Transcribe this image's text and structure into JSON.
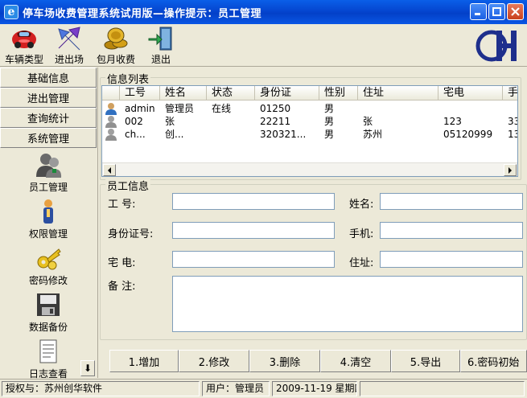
{
  "window": {
    "title": "停车场收费管理系统试用版—操作提示：员工管理",
    "app_icon_glyph": "e"
  },
  "toolbar": {
    "items": [
      {
        "label": "车辆类型",
        "icon": "red-car-icon"
      },
      {
        "label": "进出场",
        "icon": "in-out-arrows-icon"
      },
      {
        "label": "包月收费",
        "icon": "coins-icon"
      },
      {
        "label": "退出",
        "icon": "exit-door-icon"
      }
    ],
    "logo_text": "H"
  },
  "sidebar": {
    "sections": [
      "基础信息",
      "进出管理",
      "查询统计",
      "系统管理"
    ],
    "items": [
      {
        "label": "员工管理",
        "icon": "users-icon"
      },
      {
        "label": "权限管理",
        "icon": "permission-icon"
      },
      {
        "label": "密码修改",
        "icon": "keys-icon"
      },
      {
        "label": "数据备份",
        "icon": "backup-icon"
      },
      {
        "label": "日志查看",
        "icon": "log-icon"
      }
    ],
    "scroll_glyph": "⬇"
  },
  "list": {
    "group_title": "信息列表",
    "columns": [
      "",
      "工号",
      "姓名",
      "状态",
      "身份证",
      "性别",
      "住址",
      "宅电",
      "手"
    ],
    "rows": [
      [
        "",
        "admin",
        "管理员",
        "在线",
        "01250",
        "男",
        "",
        "",
        ""
      ],
      [
        "",
        "002",
        "张",
        "",
        "22211",
        "男",
        "张",
        "123",
        "33"
      ],
      [
        "",
        "ch...",
        "创...",
        "",
        "320321...",
        "男",
        "苏州",
        "05120999",
        "13"
      ]
    ]
  },
  "form": {
    "group_title": "员工信息",
    "labels": {
      "emp_id": "工    号:",
      "name": "姓名:",
      "id_card": "身份证号:",
      "mobile": "手机:",
      "home_phone": "宅    电:",
      "address": "住址:",
      "remark": "备    注:"
    },
    "values": {
      "emp_id": "",
      "name": "",
      "id_card": "",
      "mobile": "",
      "home_phone": "",
      "address": "",
      "remark": ""
    }
  },
  "actions": [
    "1.增加",
    "2.修改",
    "3.删除",
    "4.清空",
    "5.导出",
    "6.密码初始"
  ],
  "status": {
    "license": "授权与：苏州创华软件",
    "user": "用户：管理员",
    "date": "2009-11-19 星期四"
  },
  "colors": {
    "titlebar": "#0546D0",
    "face": "#ECE9D8",
    "border": "#7F9DB9"
  }
}
